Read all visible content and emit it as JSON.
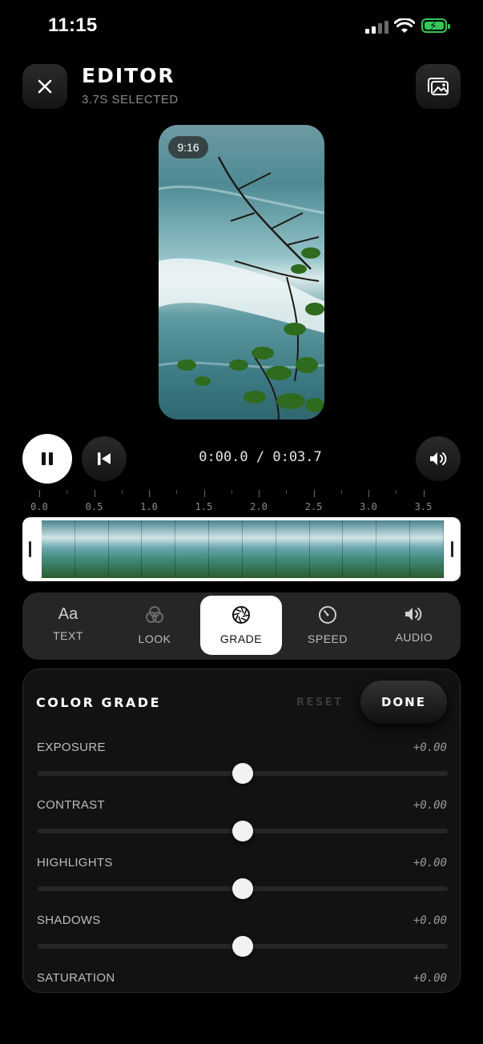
{
  "status_bar": {
    "time": "11:15"
  },
  "header": {
    "title": "EDITOR",
    "subtitle": "3.7S SELECTED"
  },
  "preview": {
    "aspect_ratio": "9:16"
  },
  "transport": {
    "timecode": "0:00.0 / 0:03.7"
  },
  "timeline": {
    "ruler_labels": [
      "0.0",
      "0.5",
      "1.0",
      "1.5",
      "2.0",
      "2.5",
      "3.0",
      "3.5"
    ],
    "frame_count": 12
  },
  "tools": [
    {
      "label": "TEXT",
      "icon": "text-aa-icon",
      "glyph": "Aa"
    },
    {
      "label": "LOOK",
      "icon": "look-circles-icon"
    },
    {
      "label": "GRADE",
      "icon": "aperture-icon",
      "active": true
    },
    {
      "label": "SPEED",
      "icon": "speedometer-icon"
    },
    {
      "label": "AUDIO",
      "icon": "speaker-icon"
    }
  ],
  "panel": {
    "title": "COLOR GRADE",
    "reset_label": "RESET",
    "done_label": "DONE",
    "sliders": [
      {
        "label": "EXPOSURE",
        "value": "+0.00",
        "level": 0.5
      },
      {
        "label": "CONTRAST",
        "value": "+0.00",
        "level": 0.5
      },
      {
        "label": "HIGHLIGHTS",
        "value": "+0.00",
        "level": 0.5
      },
      {
        "label": "SHADOWS",
        "value": "+0.00",
        "level": 0.5
      },
      {
        "label": "SATURATION",
        "value": "+0.00",
        "level": 0.5
      }
    ]
  },
  "colors": {
    "accent": "#ffffff",
    "battery": "#34c759",
    "background": "#000000",
    "panel": "#121212"
  }
}
